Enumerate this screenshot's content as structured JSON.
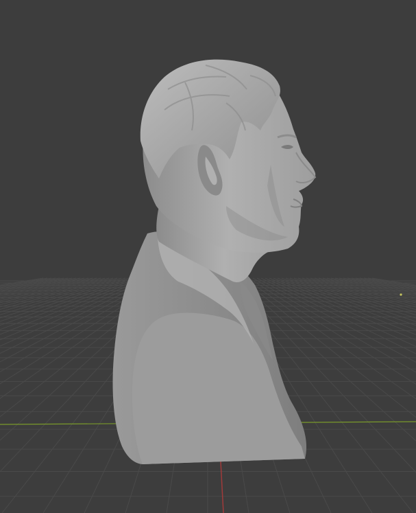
{
  "viewport": {
    "type": "3d-viewport",
    "background_color": "#3d3d3d",
    "grid_color": "#4a4a4a",
    "x_axis_color": "#7a9a2a",
    "y_axis_color": "#9a3a3a",
    "model": {
      "name": "sculpted-male-bust",
      "view": "right-side-profile",
      "material_color": "#a8a8a8",
      "cut_face_color": "#9a9a9a"
    }
  }
}
